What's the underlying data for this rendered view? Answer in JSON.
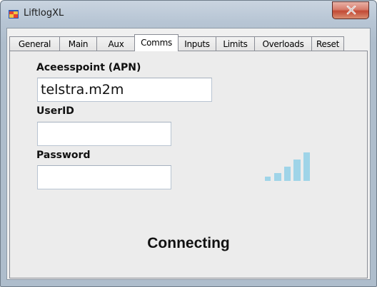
{
  "window": {
    "title": "LiftlogXL",
    "app_icon": "app-window-icon",
    "close_icon": "close-icon"
  },
  "tabs": [
    {
      "label": "General",
      "active": false
    },
    {
      "label": "Main",
      "active": false
    },
    {
      "label": "Aux",
      "active": false
    },
    {
      "label": "Comms",
      "active": true
    },
    {
      "label": "Inputs",
      "active": false
    },
    {
      "label": "Limits",
      "active": false
    },
    {
      "label": "Overloads",
      "active": false
    },
    {
      "label": "Reset",
      "active": false
    }
  ],
  "comms": {
    "apn_label": "Aceesspoint (APN)",
    "apn_value": "telstra.m2m",
    "userid_label": "UserID",
    "userid_value": "",
    "password_label": "Password",
    "password_value": "",
    "signal_icon": "signal-strength-icon",
    "signal_bars_filled": 5,
    "signal_color": "#9fd4e8",
    "status_text": "Connecting"
  }
}
